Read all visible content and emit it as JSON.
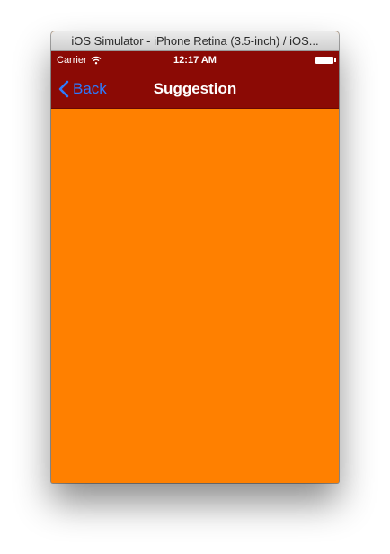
{
  "window": {
    "title": "iOS Simulator - iPhone Retina (3.5-inch) / iOS..."
  },
  "status_bar": {
    "carrier": "Carrier",
    "time": "12:17 AM",
    "wifi_icon": "wifi-icon",
    "battery_icon": "battery-icon"
  },
  "nav_bar": {
    "back_label": "Back",
    "back_icon": "chevron-left-icon",
    "title": "Suggestion"
  },
  "colors": {
    "nav_background": "#8b0a05",
    "content_background": "#ff8000",
    "back_tint": "#2c7bff"
  }
}
